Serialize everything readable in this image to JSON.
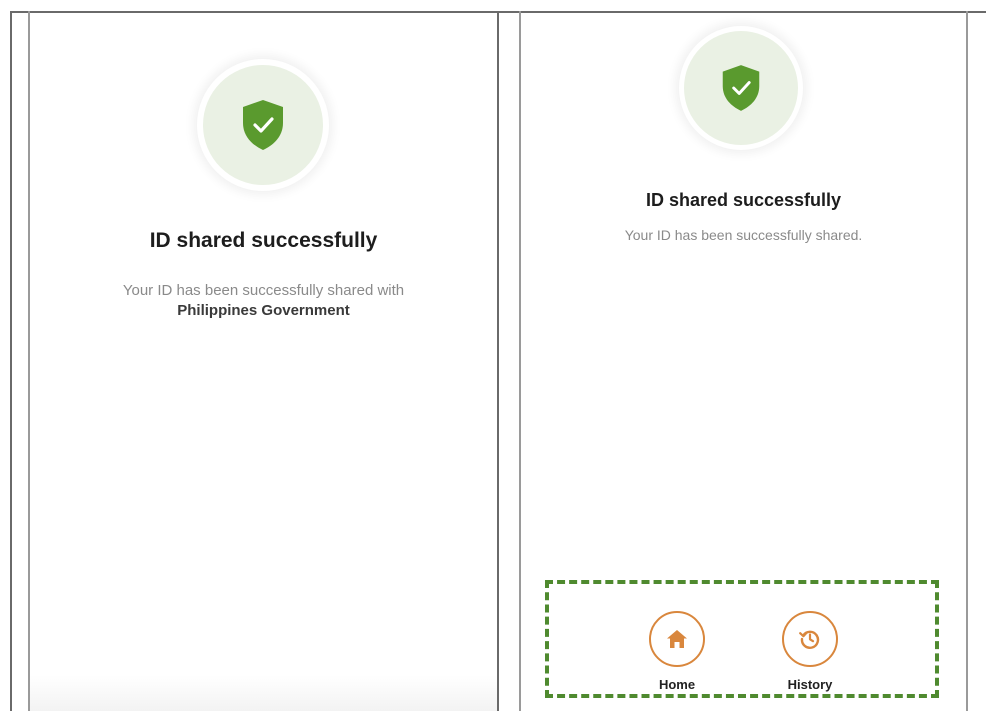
{
  "left_screen": {
    "icon": "shield-check-icon",
    "title": "ID shared successfully",
    "description": "Your ID has been successfully shared with",
    "organization": "Philippines Government"
  },
  "right_screen": {
    "icon": "shield-check-icon",
    "title": "ID shared successfully",
    "description": "Your ID has been successfully shared.",
    "nav": {
      "home": {
        "label": "Home",
        "icon": "home-icon"
      },
      "history": {
        "label": "History",
        "icon": "history-icon"
      }
    }
  },
  "colors": {
    "shield": "#5a9a2e",
    "shield_bg": "#eaf1e4",
    "accent": "#d9873d",
    "highlight_dash": "#4f8a2f"
  }
}
